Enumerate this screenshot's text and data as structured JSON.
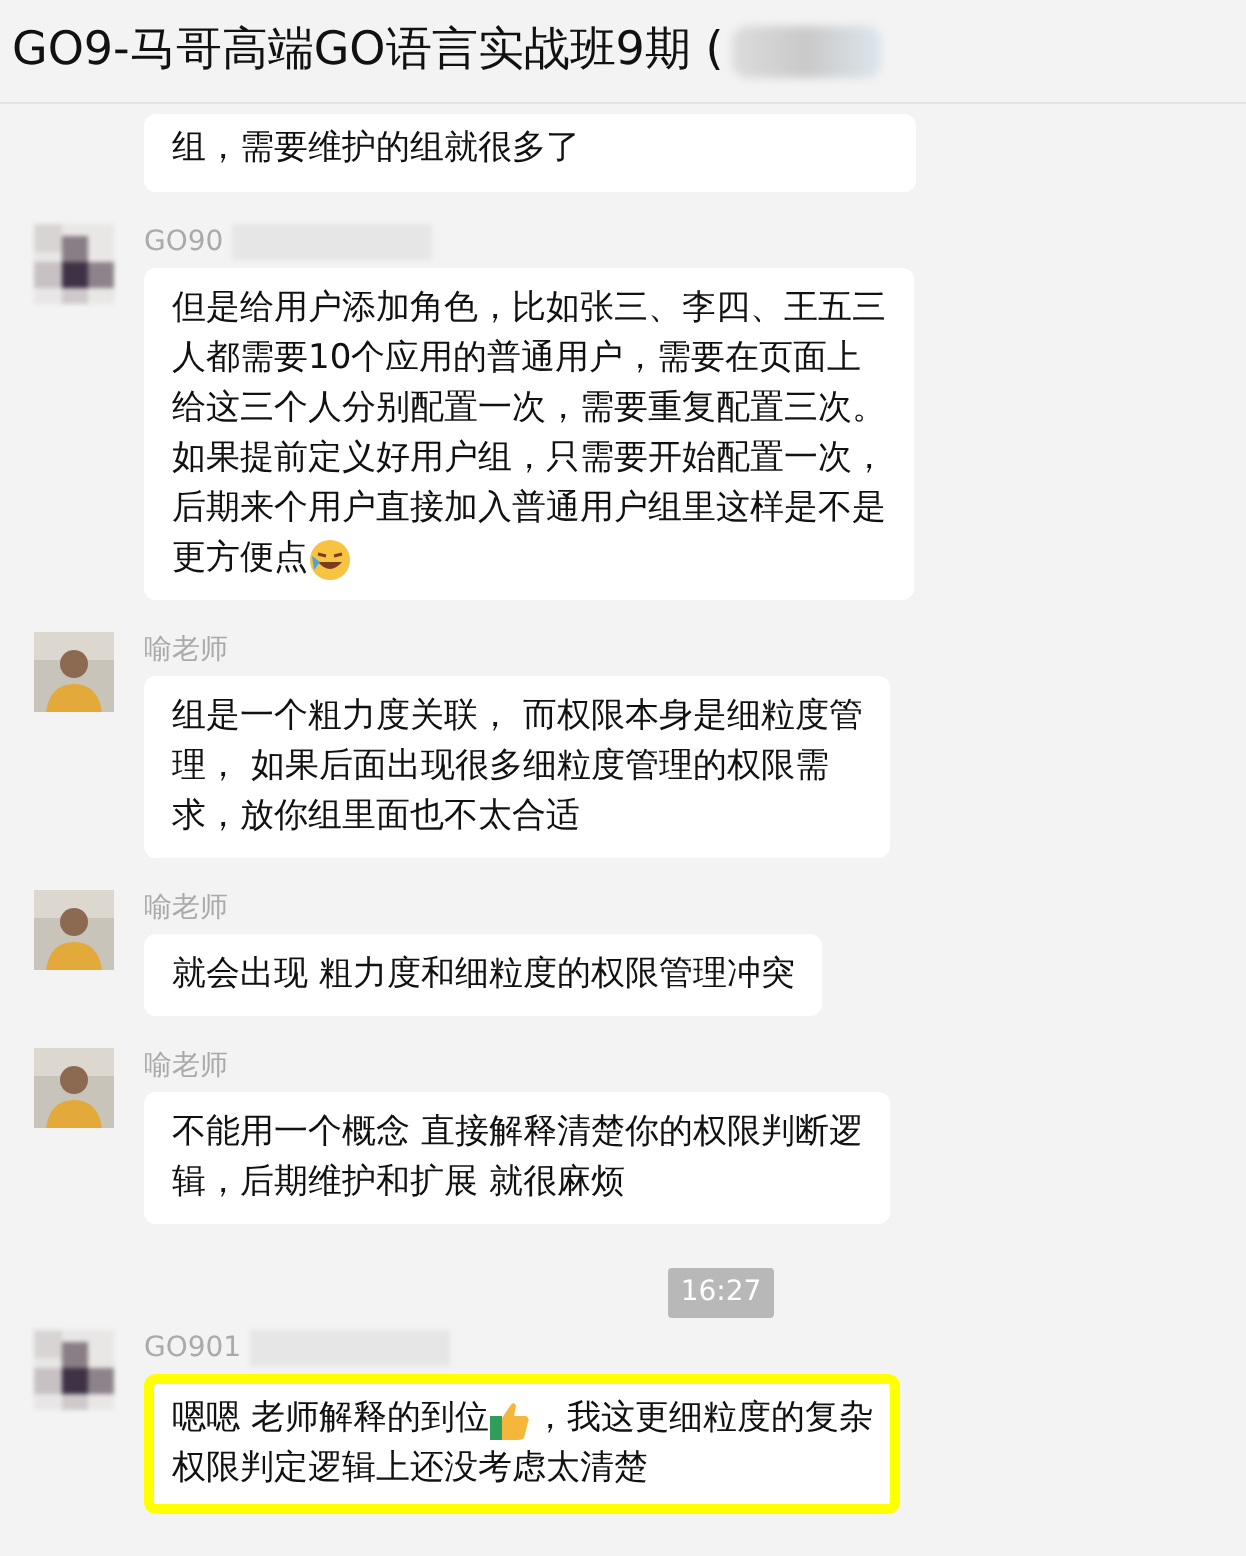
{
  "window": {
    "title": "GO9-马哥高端GO语言实战班9期 ("
  },
  "messages": [
    {
      "kind": "partial",
      "lines": [
        [
          {
            "kind": "text",
            "text": "组，需要维护的组就很多了"
          }
        ]
      ]
    },
    {
      "kind": "message",
      "sender": "GO90",
      "name_redacted": true,
      "highlighted": false,
      "lines": [
        [
          {
            "kind": "text",
            "text": "但是给用户添加角色，比如张三、李四、王五三"
          }
        ],
        [
          {
            "kind": "text",
            "text": "人都需要10个应用的普通用户，需要在页面上"
          }
        ],
        [
          {
            "kind": "text",
            "text": "给这三个人分别配置一次，需要重复配置三次。"
          }
        ],
        [
          {
            "kind": "text",
            "text": "如果提前定义好用户组，只需要开始配置一次，"
          }
        ],
        [
          {
            "kind": "text",
            "text": "后期来个用户直接加入普通用户组里这样是不是"
          }
        ],
        [
          {
            "kind": "text",
            "text": "更方便点"
          },
          {
            "kind": "emoji-face"
          }
        ]
      ]
    },
    {
      "kind": "message",
      "sender": "喻老师",
      "name_redacted": false,
      "highlighted": false,
      "lines": [
        [
          {
            "kind": "text",
            "text": "组是一个粗力度关联， 而权限本身是细粒度管"
          }
        ],
        [
          {
            "kind": "text",
            "text": "理， 如果后面出现很多细粒度管理的权限需"
          }
        ],
        [
          {
            "kind": "text",
            "text": "求，放你组里面也不太合适"
          }
        ]
      ]
    },
    {
      "kind": "message",
      "sender": "喻老师",
      "name_redacted": false,
      "highlighted": false,
      "lines": [
        [
          {
            "kind": "text",
            "text": "就会出现 粗力度和细粒度的权限管理冲突"
          }
        ]
      ]
    },
    {
      "kind": "message",
      "sender": "喻老师",
      "name_redacted": false,
      "highlighted": false,
      "lines": [
        [
          {
            "kind": "text",
            "text": "不能用一个概念 直接解释清楚你的权限判断逻"
          }
        ],
        [
          {
            "kind": "text",
            "text": "辑，后期维护和扩展 就很麻烦"
          }
        ]
      ]
    },
    {
      "kind": "time",
      "text": "16:27"
    },
    {
      "kind": "message",
      "sender": "GO901",
      "name_redacted": true,
      "highlighted": true,
      "lines": [
        [
          {
            "kind": "text",
            "text": "嗯嗯 老师解释的到位"
          },
          {
            "kind": "emoji-hand"
          },
          {
            "kind": "text",
            "text": "，我这更细粒度的复杂"
          }
        ],
        [
          {
            "kind": "text",
            "text": "权限判定逻辑上还没考虑太清楚"
          }
        ]
      ]
    }
  ]
}
